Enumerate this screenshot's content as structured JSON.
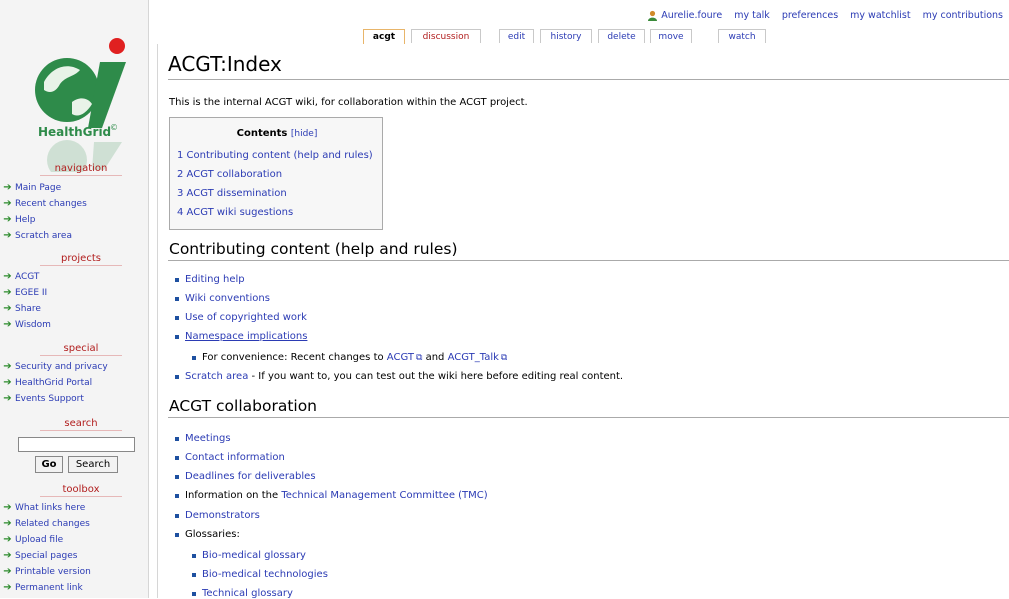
{
  "user_bar": {
    "username": "Aurelie.foure",
    "links": [
      "my talk",
      "preferences",
      "my watchlist",
      "my contributions"
    ]
  },
  "tabs": [
    {
      "label": "acgt",
      "active": true
    },
    {
      "label": "discussion"
    },
    {
      "label": "edit"
    },
    {
      "label": "history"
    },
    {
      "label": "delete"
    },
    {
      "label": "move"
    },
    {
      "label": "watch"
    }
  ],
  "logo": {
    "text": "HealthGrid",
    "mark": "©"
  },
  "sidebar": {
    "navigation": {
      "title": "navigation",
      "items": [
        "Main Page",
        "Recent changes",
        "Help",
        "Scratch area"
      ]
    },
    "projects": {
      "title": "projects",
      "items": [
        "ACGT",
        "EGEE II",
        "Share",
        "Wisdom"
      ]
    },
    "special": {
      "title": "special",
      "items": [
        "Security and privacy",
        "HealthGrid Portal",
        "Events Support"
      ]
    },
    "search": {
      "title": "search",
      "go_label": "Go",
      "search_label": "Search",
      "value": ""
    },
    "toolbox": {
      "title": "toolbox",
      "items": [
        "What links here",
        "Related changes",
        "Upload file",
        "Special pages",
        "Printable version",
        "Permanent link"
      ]
    }
  },
  "page": {
    "title": "ACGT:Index",
    "intro": "This is the internal ACGT wiki, for collaboration within the ACGT project.",
    "toc": {
      "title": "Contents",
      "hide_label": "[hide]",
      "items": [
        "1 Contributing content (help and rules)",
        "2 ACGT collaboration",
        "3 ACGT dissemination",
        "4 ACGT wiki sugestions"
      ]
    },
    "section1": {
      "heading": "Contributing content (help and rules)",
      "items": [
        "Editing help",
        "Wiki conventions",
        "Use of copyrighted work",
        "Namespace implications"
      ],
      "sub_prefix": "For convenience: Recent changes to",
      "sub_link1": "ACGT",
      "sub_and": "and",
      "sub_link2": "ACGT_Talk",
      "scratch_link": "Scratch area",
      "scratch_text": " - If you want to, you can test out the wiki here before editing real content."
    },
    "section2": {
      "heading": "ACGT collaboration",
      "meetings": "Meetings",
      "contact": "Contact information",
      "deadlines": "Deadlines for deliverables",
      "tmc_prefix": "Information on the",
      "tmc_link": "Technical Management Committee (TMC)",
      "demonstrators": "Demonstrators",
      "glossaries": "Glossaries:",
      "glossary_items": [
        "Bio-medical glossary",
        "Bio-medical technologies",
        "Technical glossary"
      ]
    }
  },
  "colors": {
    "link": "#2b3bb4",
    "sidebar_title": "#b11d1d",
    "nav_arrow": "#2b8a2b"
  }
}
